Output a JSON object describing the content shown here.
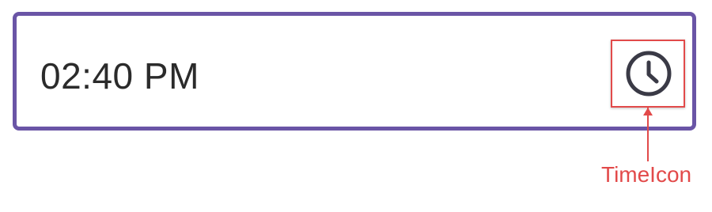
{
  "time_picker": {
    "value": "02:40 PM",
    "icon": "clock-icon",
    "border_color": "#6a55a6",
    "text_color": "#2b2b2b",
    "icon_color": "#3a3a46"
  },
  "annotation": {
    "label": "TimeIcon",
    "color": "#e24a4a"
  }
}
